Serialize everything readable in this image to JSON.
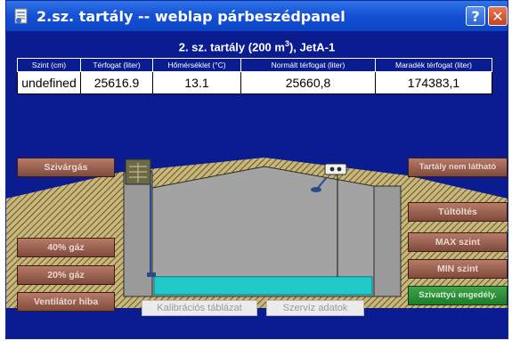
{
  "window": {
    "title": "2.sz. tartály -- weblap párbeszédpanel",
    "help_label": "?",
    "close_label": "✕"
  },
  "tank": {
    "heading_main": "2. sz. tartály (200 m",
    "heading_sup": "3",
    "heading_tail": "), JetA-1"
  },
  "table": {
    "headers": [
      "Szint (cm)",
      "Térfogat (liter)",
      "Hőmérséklet (°C)",
      "Normált térfogat (liter)",
      "Maradék térfogat (liter)"
    ],
    "values": [
      "undefined",
      "25616.9",
      "13.1",
      "25660,8",
      "174383,1"
    ]
  },
  "buttons": {
    "leak": "Szivárgás",
    "gas40": "40% gáz",
    "gas20": "20% gáz",
    "fan_fault": "Ventilátor hiba",
    "tank_not_visible": "Tartály nem látható",
    "overfill": "Túltöltés",
    "max_level": "MAX szint",
    "min_level": "MIN szint",
    "pump_enabled": "Szivattyú engedély.",
    "calibration": "Kalibrációs táblázat",
    "service": "Szervíz adatok"
  },
  "liquid_level_fraction": 0.1
}
